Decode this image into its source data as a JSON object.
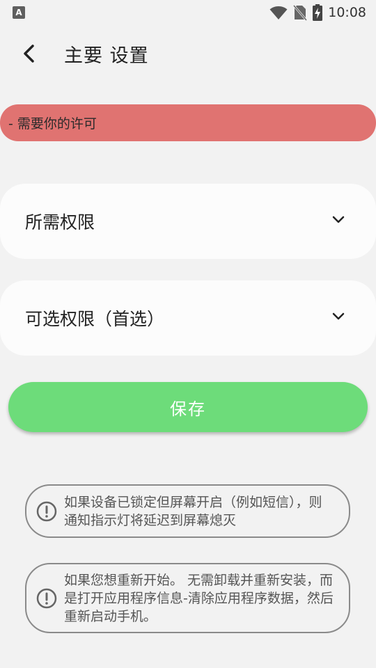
{
  "status_bar": {
    "app_badge": "A",
    "time": "10:08",
    "icons": [
      "wifi-icon",
      "no-sim-icon",
      "battery-charging-icon"
    ]
  },
  "app_bar": {
    "back_icon": "back-arrow-icon",
    "title": "主要 设置"
  },
  "banner": {
    "text": "- 需要你的许可",
    "color": "#e07371"
  },
  "sections": [
    {
      "label": "所需权限",
      "icon": "chevron-down-icon"
    },
    {
      "label": "可选权限（首选）",
      "icon": "chevron-down-icon"
    }
  ],
  "save_button": {
    "label": "保存",
    "color": "#6ddc7a"
  },
  "info": [
    {
      "icon": "alert-circle-icon",
      "text": "如果设备已锁定但屏幕开启（例如短信），则通知指示灯将延迟到屏幕熄灭"
    },
    {
      "icon": "alert-circle-icon",
      "text": "如果您想重新开始。 无需卸载并重新安装，而是打开应用程序信息-清除应用程序数据，然后重新启动手机。"
    }
  ]
}
